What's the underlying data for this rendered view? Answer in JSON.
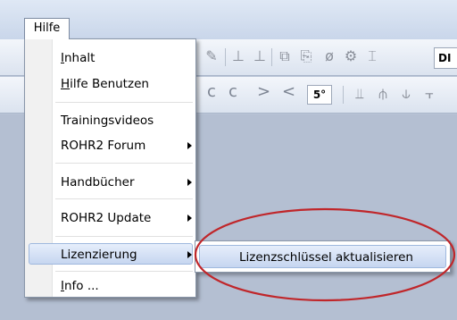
{
  "menubar": {
    "hilfe_label": "Hilfe"
  },
  "toolbar": {
    "angle_value": "5°",
    "di_value": "DI"
  },
  "help_menu": {
    "items": [
      {
        "label_underline": "I",
        "label_rest": "nhalt"
      },
      {
        "label_underline": "H",
        "label_rest": "ilfe Benutzen"
      },
      {
        "label": "Trainingsvideos"
      },
      {
        "label": "ROHR2 Forum",
        "submenu": true
      },
      {
        "label": "Handbücher",
        "submenu": true
      },
      {
        "label": "ROHR2 Update",
        "submenu": true
      },
      {
        "label": "Lizenzierung",
        "submenu": true,
        "highlighted": true
      },
      {
        "label_underline": "I",
        "label_rest": "nfo ..."
      }
    ]
  },
  "submenu": {
    "item_label": "Lizenzschlüssel aktualisieren"
  },
  "annotation": {
    "ellipse_color": "#c0262a"
  }
}
